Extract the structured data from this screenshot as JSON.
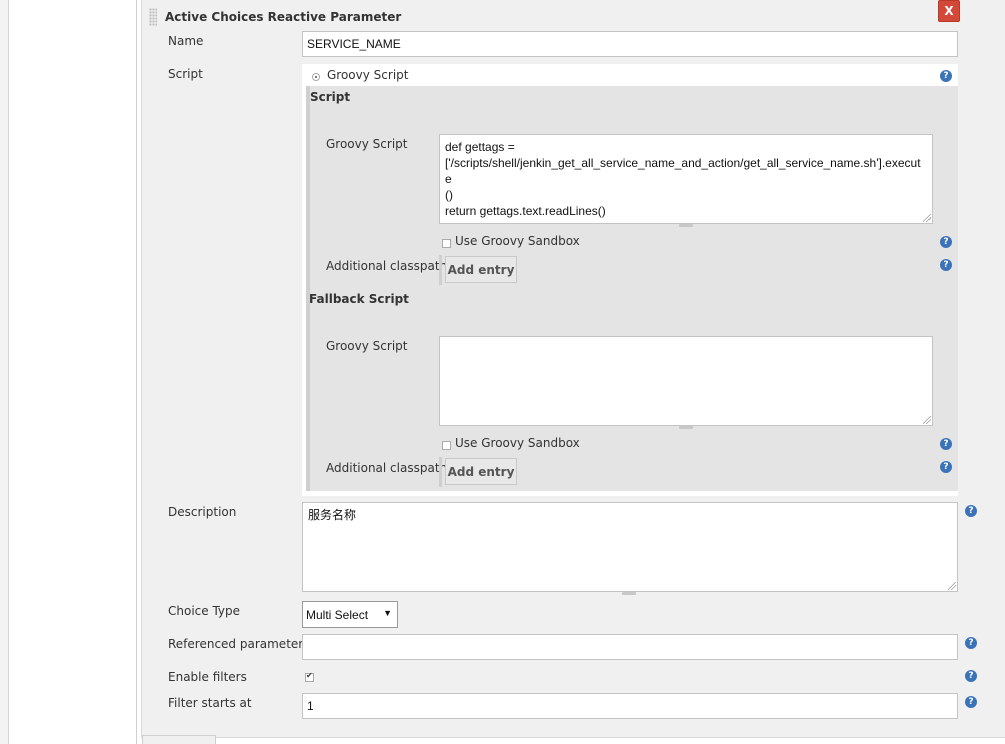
{
  "header": {
    "title": "Active Choices Reactive Parameter",
    "delete_label": "X"
  },
  "name": {
    "label": "Name",
    "value": "SERVICE_NAME"
  },
  "script": {
    "label": "Script",
    "radio_label": "Groovy Script",
    "section_title": "Script",
    "groovy_label": "Groovy Script",
    "groovy_value": "def gettags =\n['/scripts/shell/jenkin_get_all_service_name_and_action/get_all_service_name.sh'].execute\n()\nreturn gettags.text.readLines()",
    "sandbox_label": "Use Groovy Sandbox",
    "classpath_label": "Additional classpath",
    "add_entry_label": "Add entry"
  },
  "fallback": {
    "section_title": "Fallback Script",
    "groovy_label": "Groovy Script",
    "groovy_value": "",
    "sandbox_label": "Use Groovy Sandbox",
    "classpath_label": "Additional classpath",
    "add_entry_label": "Add entry"
  },
  "description": {
    "label": "Description",
    "value": "服务名称"
  },
  "choice_type": {
    "label": "Choice Type",
    "value": "Multi Select"
  },
  "referenced": {
    "label": "Referenced parameters",
    "value": ""
  },
  "filters": {
    "label": "Enable filters",
    "checked": true
  },
  "filter_start": {
    "label": "Filter starts at",
    "value": "1"
  },
  "icons": {
    "help": "?",
    "help_icon": "question-circle-icon"
  },
  "colors": {
    "delete_red": "#d24939",
    "help_blue": "#3b73b9",
    "panel_bg": "#f0f0f0"
  }
}
